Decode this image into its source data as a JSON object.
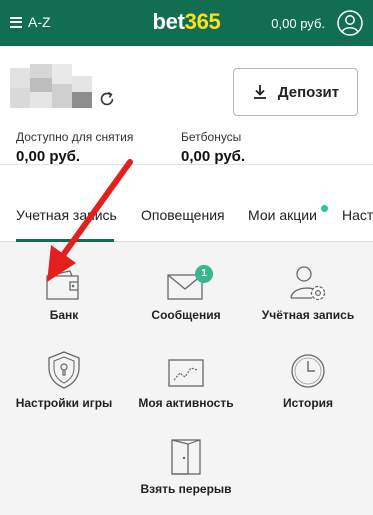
{
  "header": {
    "menu_label": "A-Z",
    "logo_part1": "bet",
    "logo_part2": "365",
    "balance": "0,00 руб."
  },
  "account": {
    "deposit_label": "Депозит",
    "withdrawable_label": "Доступно для снятия",
    "withdrawable_value": "0,00 руб.",
    "bonus_label": "Бетбонусы",
    "bonus_value": "0,00 руб."
  },
  "tabs": [
    {
      "label": "Учетная запись",
      "active": true
    },
    {
      "label": "Оповещения",
      "active": false
    },
    {
      "label": "Мои акции",
      "active": false,
      "has_dot": true
    },
    {
      "label": "Настройки",
      "active": false
    }
  ],
  "grid": [
    {
      "label": "Банк",
      "icon": "wallet-icon"
    },
    {
      "label": "Сообщения",
      "icon": "envelope-icon",
      "badge": "1"
    },
    {
      "label": "Учётная запись",
      "icon": "account-settings-icon"
    },
    {
      "label": "Настройки игры",
      "icon": "shield-lock-icon"
    },
    {
      "label": "Моя активность",
      "icon": "activity-chart-icon"
    },
    {
      "label": "История",
      "icon": "clock-icon"
    },
    {
      "label": "Взять перерыв",
      "icon": "door-icon"
    }
  ],
  "colors": {
    "brand_green": "#126e51",
    "logo_yellow": "#ffdf1b",
    "badge_green": "#37b68f",
    "annotation_red": "#e4201e"
  }
}
